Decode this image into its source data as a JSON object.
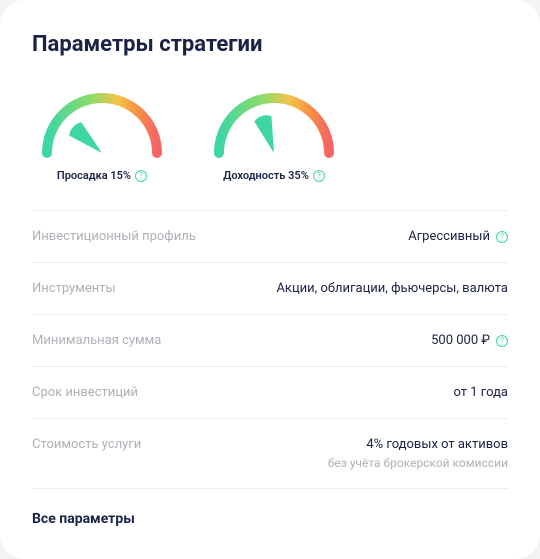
{
  "title": "Параметры стратегии",
  "gauges": {
    "drawdown": {
      "label": "Просадка 15%",
      "percent": 15
    },
    "yield": {
      "label": "Доходность 35%",
      "percent": 35
    }
  },
  "params": {
    "profile": {
      "label": "Инвестиционный профиль",
      "value": "Агрессивный",
      "has_info": true
    },
    "instruments": {
      "label": "Инструменты",
      "value": "Акции, облигации, фьючерсы, валюта"
    },
    "min_sum": {
      "label": "Минимальная сумма",
      "value": "500 000 ₽",
      "has_info": true
    },
    "term": {
      "label": "Срок инвестиций",
      "value": "от 1 года"
    },
    "cost": {
      "label": "Стоимость услуги",
      "value": "4% годовых от активов",
      "sub": "без учёта брокерской комиссии"
    }
  },
  "all_params_label": "Все параметры",
  "info_glyph": "?",
  "chart_data": [
    {
      "type": "gauge",
      "title": "Просадка",
      "value": 15,
      "unit": "%",
      "range": [
        0,
        100
      ]
    },
    {
      "type": "gauge",
      "title": "Доходность",
      "value": 35,
      "unit": "%",
      "range": [
        0,
        100
      ]
    }
  ]
}
